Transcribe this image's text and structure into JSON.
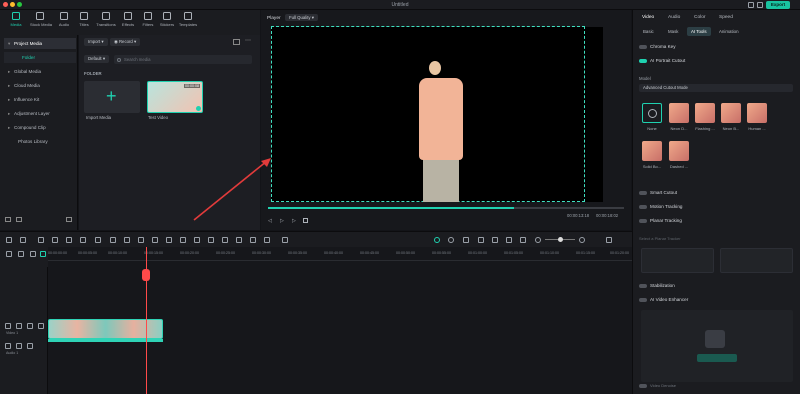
{
  "window": {
    "title": "Untitled",
    "export_label": "Export"
  },
  "toolbar": [
    {
      "label": "Media",
      "icon": "media-icon",
      "active": true
    },
    {
      "label": "Stock Media",
      "icon": "stock-media-icon"
    },
    {
      "label": "Audio",
      "icon": "audio-icon"
    },
    {
      "label": "Titles",
      "icon": "titles-icon"
    },
    {
      "label": "Transitions",
      "icon": "transitions-icon"
    },
    {
      "label": "Effects",
      "icon": "effects-icon"
    },
    {
      "label": "Filters",
      "icon": "filters-icon"
    },
    {
      "label": "Stickers",
      "icon": "stickers-icon"
    },
    {
      "label": "Templates",
      "icon": "templates-icon"
    }
  ],
  "leftnav": {
    "items": [
      "Project Media",
      "Folder",
      "Global Media",
      "Cloud Media",
      "Influence Kit",
      "Adjustment Layer",
      "Compound Clip",
      "Photos Library"
    ]
  },
  "media": {
    "import_label": "Import",
    "record_label": "Record",
    "sort_label": "Default",
    "search_placeholder": "Search media",
    "folder_header": "FOLDER",
    "import_media_label": "Import Media",
    "test_video_label": "Test Video",
    "test_video_duration": "00:00:08"
  },
  "player": {
    "tab_label": "Player",
    "quality": "Full Quality",
    "current_time": "00:00:13:18",
    "total_time": "00:00:18:02",
    "progress": 0.69
  },
  "rpanel": {
    "tabs": [
      "Video",
      "Audio",
      "Color",
      "Speed"
    ],
    "subtabs": [
      "Basic",
      "Mask",
      "AI Tools",
      "Animation"
    ],
    "chroma_key": "Chroma Key",
    "ai_portrait": "AI Portrait Cutout",
    "model_label": "Model",
    "model_value": "Advanced Cutout Mode",
    "effects": [
      "None",
      "Neon D...",
      "Flashing ...",
      "Neon B...",
      "Human ...",
      "Solid Bo...",
      "Dashed ..."
    ],
    "smart_cutout": "Smart Cutout",
    "motion_tracking": "Motion Tracking",
    "planar_tracking": "Planar Tracking",
    "planar_placeholder": "Select a Planar Tracker",
    "stabilization": "Stabilization",
    "ai_video_enhancer": "AI Video Enhancer",
    "video_denoise": "Video Denoise"
  },
  "timeline": {
    "ticks": [
      "00:00:00:00",
      "00:00:05:00",
      "00:00:10:00",
      "00:00:15:00",
      "00:00:20:00",
      "00:00:25:00",
      "00:00:30:00",
      "00:00:35:00",
      "00:00:40:00",
      "00:00:45:00",
      "00:00:50:00",
      "00:00:55:00",
      "00:01:00:00",
      "00:01:05:00",
      "00:01:10:00",
      "00:01:15:00",
      "00:01:20:00"
    ],
    "video_track": "Video 1",
    "audio_track": "Audio 1"
  },
  "colors": {
    "accent": "#1fd1b0",
    "playhead": "#ff4a4a",
    "arrow": "#e23b3b"
  }
}
